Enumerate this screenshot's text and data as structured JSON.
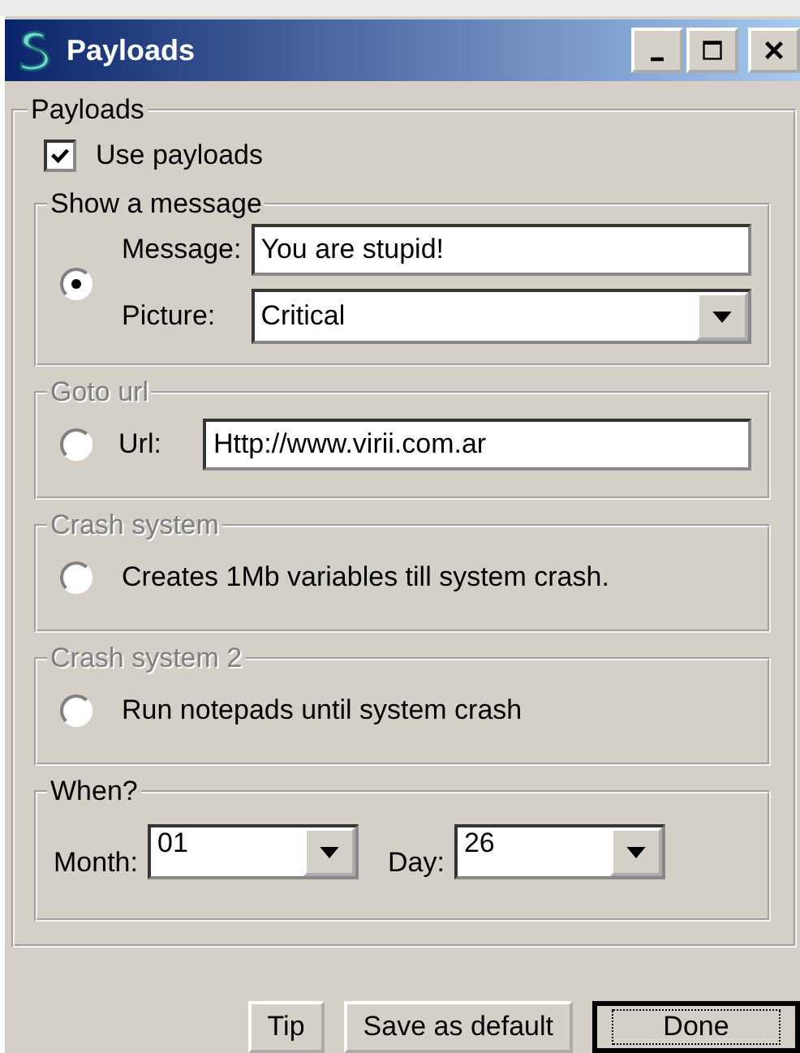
{
  "window": {
    "title": "Payloads"
  },
  "payloads": {
    "title": "Payloads",
    "use_payloads": {
      "label": "Use payloads",
      "checked": true
    },
    "options": [
      {
        "kind": "message",
        "title": "Show a message",
        "enabled": true,
        "selected": true,
        "message_label": "Message:",
        "message": "You are stupid!",
        "picture_label": "Picture:",
        "picture": "Critical"
      },
      {
        "kind": "url",
        "title": "Goto url",
        "enabled": false,
        "selected": false,
        "label": "Url:",
        "value": "Http://www.virii.com.ar"
      },
      {
        "kind": "text",
        "title": "Crash system",
        "enabled": false,
        "selected": false,
        "label": "Creates 1Mb variables till system crash."
      },
      {
        "kind": "text",
        "title": "Crash system 2",
        "enabled": false,
        "selected": false,
        "label": "Run notepads until system crash"
      }
    ],
    "when": {
      "title": "When?",
      "month_label": "Month:",
      "month": "01",
      "day_label": "Day:",
      "day": "26"
    }
  },
  "buttons": [
    {
      "label": "Tip",
      "default": false
    },
    {
      "label": "Save as default",
      "default": false
    },
    {
      "label": "Done",
      "default": true
    }
  ]
}
